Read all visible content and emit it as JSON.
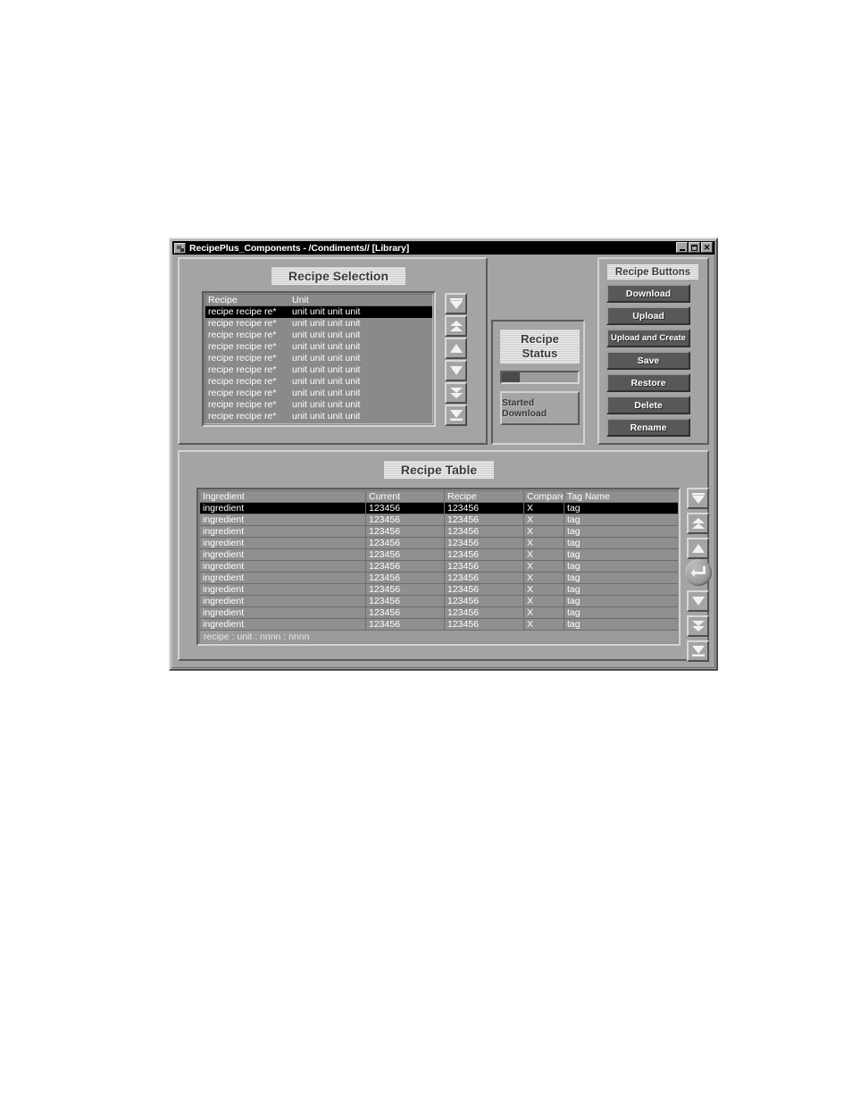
{
  "window": {
    "title": "RecipePlus_Components - /Condiments// [Library]",
    "icon": "app-icon",
    "controls": {
      "minimize": "minimize-icon",
      "maximize": "maximize-icon",
      "close": "close-icon"
    }
  },
  "recipe_selection": {
    "title": "Recipe Selection",
    "columns": [
      "Recipe",
      "Unit"
    ],
    "rows": [
      {
        "recipe": "recipe recipe re*",
        "unit": "unit unit unit unit",
        "selected": true
      },
      {
        "recipe": "recipe recipe re*",
        "unit": "unit unit unit unit",
        "selected": false
      },
      {
        "recipe": "recipe recipe re*",
        "unit": "unit unit unit unit",
        "selected": false
      },
      {
        "recipe": "recipe recipe re*",
        "unit": "unit unit unit unit",
        "selected": false
      },
      {
        "recipe": "recipe recipe re*",
        "unit": "unit unit unit unit",
        "selected": false
      },
      {
        "recipe": "recipe recipe re*",
        "unit": "unit unit unit unit",
        "selected": false
      },
      {
        "recipe": "recipe recipe re*",
        "unit": "unit unit unit unit",
        "selected": false
      },
      {
        "recipe": "recipe recipe re*",
        "unit": "unit unit unit unit",
        "selected": false
      },
      {
        "recipe": "recipe recipe re*",
        "unit": "unit unit unit unit",
        "selected": false
      },
      {
        "recipe": "recipe recipe re*",
        "unit": "unit unit unit unit",
        "selected": false
      }
    ],
    "scroll_buttons": [
      "scroll-top-icon",
      "scroll-page-up-icon",
      "scroll-up-icon",
      "scroll-down-icon",
      "scroll-page-down-icon",
      "scroll-bottom-icon"
    ]
  },
  "recipe_status": {
    "title": "Recipe Status",
    "progress_percent": 24,
    "status_text": "Started Download"
  },
  "recipe_buttons": {
    "title": "Recipe Buttons",
    "buttons": [
      "Download",
      "Upload",
      "Upload and Create",
      "Save",
      "Restore",
      "Delete",
      "Rename"
    ]
  },
  "recipe_table": {
    "title": "Recipe Table",
    "columns": [
      "Ingredient",
      "Current",
      "Recipe",
      "Compare",
      "Tag Name"
    ],
    "rows": [
      {
        "ingredient": "ingredient",
        "current": "123456",
        "recipe": "123456",
        "compare": "X",
        "tag": "tag",
        "selected": true
      },
      {
        "ingredient": "ingredient",
        "current": "123456",
        "recipe": "123456",
        "compare": "X",
        "tag": "tag",
        "selected": false
      },
      {
        "ingredient": "ingredient",
        "current": "123456",
        "recipe": "123456",
        "compare": "X",
        "tag": "tag",
        "selected": false
      },
      {
        "ingredient": "ingredient",
        "current": "123456",
        "recipe": "123456",
        "compare": "X",
        "tag": "tag",
        "selected": false
      },
      {
        "ingredient": "ingredient",
        "current": "123456",
        "recipe": "123456",
        "compare": "X",
        "tag": "tag",
        "selected": false
      },
      {
        "ingredient": "ingredient",
        "current": "123456",
        "recipe": "123456",
        "compare": "X",
        "tag": "tag",
        "selected": false
      },
      {
        "ingredient": "ingredient",
        "current": "123456",
        "recipe": "123456",
        "compare": "X",
        "tag": "tag",
        "selected": false
      },
      {
        "ingredient": "ingredient",
        "current": "123456",
        "recipe": "123456",
        "compare": "X",
        "tag": "tag",
        "selected": false
      },
      {
        "ingredient": "ingredient",
        "current": "123456",
        "recipe": "123456",
        "compare": "X",
        "tag": "tag",
        "selected": false
      },
      {
        "ingredient": "ingredient",
        "current": "123456",
        "recipe": "123456",
        "compare": "X",
        "tag": "tag",
        "selected": false
      },
      {
        "ingredient": "ingredient",
        "current": "123456",
        "recipe": "123456",
        "compare": "X",
        "tag": "tag",
        "selected": false
      }
    ],
    "status_text": "recipe : unit : nnnn : nnnn",
    "scroll_buttons": [
      "scroll-top-icon",
      "scroll-page-up-icon",
      "scroll-up-icon",
      "enter-icon",
      "scroll-down-icon",
      "scroll-page-down-icon",
      "scroll-bottom-icon"
    ]
  },
  "colors": {
    "face": "#a4a4a4",
    "selection": "#000000",
    "button_face": "#585858",
    "plate": "#d8d8d8",
    "progress_fill": "#4a4a4a"
  }
}
